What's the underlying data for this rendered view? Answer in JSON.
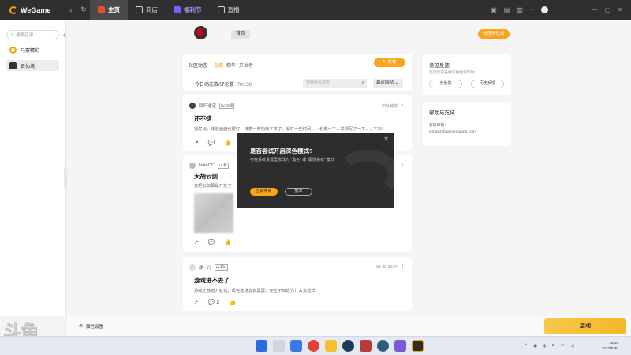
{
  "app": {
    "logo_text": "WeGame",
    "nav": {
      "back": "‹",
      "refresh": "↻"
    },
    "tabs": [
      {
        "label": "主页",
        "icon": "home-icon",
        "color": "#e94b2b"
      },
      {
        "label": "商店",
        "icon": "store-icon",
        "color": "#cfcfcf"
      },
      {
        "label": "福利节",
        "icon": "gift-icon",
        "color": "#7c5cff"
      },
      {
        "label": "直播",
        "icon": "live-icon",
        "color": "#cfcfcf"
      }
    ],
    "window_controls": [
      "⋮",
      "—",
      "▢",
      "✕"
    ]
  },
  "sidebar": {
    "search_placeholder": "搜索应用",
    "add": "+",
    "items": [
      {
        "label": "马赛精彩",
        "icon": "game-icon"
      },
      {
        "label": "云仙境",
        "icon": "game-icon"
      }
    ],
    "collapse": "‹"
  },
  "game_header": {
    "home_label": "首页",
    "forum_button": "去官网论坛"
  },
  "feed": {
    "section_title": "社区动态",
    "filters": [
      "全部",
      "精华",
      "开发者"
    ],
    "post_button": "✎ 发帖",
    "count_label": "今日动态数/评论数",
    "count_value": "70/150",
    "search_placeholder": "搜索社区动态",
    "sort_label": "最近回帖 ⌄"
  },
  "posts": [
    {
      "author": "回归选定",
      "level": "Lv.20级",
      "time": "20分钟前",
      "title": "还不错",
      "body": "挺好玩，体验画面也很好，接着一开始就下来了，挺好一些时间……也做一下，发现写了一下，...下次/",
      "actions": [
        "↗",
        "💬",
        "👍"
      ]
    },
    {
      "author": "NateCC",
      "level": "Lv.新",
      "time": "",
      "title": "天胡云剑",
      "body": "这把云剑算是开挂了",
      "actions": [
        "↗",
        "💬",
        "👍"
      ]
    },
    {
      "author": "静 · 儿",
      "level": "Lv.新X",
      "time": "05-28 18:27",
      "title": "游戏进不去了",
      "body": "游戏之前进入就玩，现在总进去就黑屏，完全不知道为什么会这样",
      "actions": [
        "↗",
        "💬 2",
        "👍"
      ]
    }
  ],
  "feedback_panel": {
    "title": "意见反馈",
    "subtitle": "您对您的各种问题给您帮助",
    "buttons": [
      "去反馈",
      "历史反馈"
    ]
  },
  "help_panel": {
    "title": "帮助与支持",
    "email_label": "客服邮箱：",
    "email": "contact@gamersgame.com"
  },
  "dialog": {
    "title": "是否尝试开启深色模式?",
    "message": "可在系统设置里修改为 “浅色” 或 “跟随系统” 模式",
    "confirm": "立即开启",
    "cancel": "暂不",
    "close": "✕"
  },
  "bottom": {
    "settings_label": "属性设置",
    "launch_label": "启动"
  },
  "watermark": {
    "logo": "斗鱼",
    "number": "5147240"
  },
  "taskbar": {
    "apps": [
      {
        "icon": "start-icon",
        "color": "#2b6de0"
      },
      {
        "icon": "search-icon",
        "color": "#cfd6e2"
      },
      {
        "icon": "windows-icon",
        "color": "#3b78e7"
      },
      {
        "icon": "chrome-icon",
        "color": "#e34133"
      },
      {
        "icon": "folder-icon",
        "color": "#f2c230"
      },
      {
        "icon": "steam-icon",
        "color": "#1b3a5c"
      },
      {
        "icon": "app-icon",
        "color": "#b83c3c"
      },
      {
        "icon": "app-icon",
        "color": "#2f5b7e"
      },
      {
        "icon": "app-icon",
        "color": "#7b5ad8"
      },
      {
        "icon": "wegame-icon",
        "color": "#2d2d2d"
      }
    ],
    "time": "15:48",
    "date": "2022/5/30"
  }
}
